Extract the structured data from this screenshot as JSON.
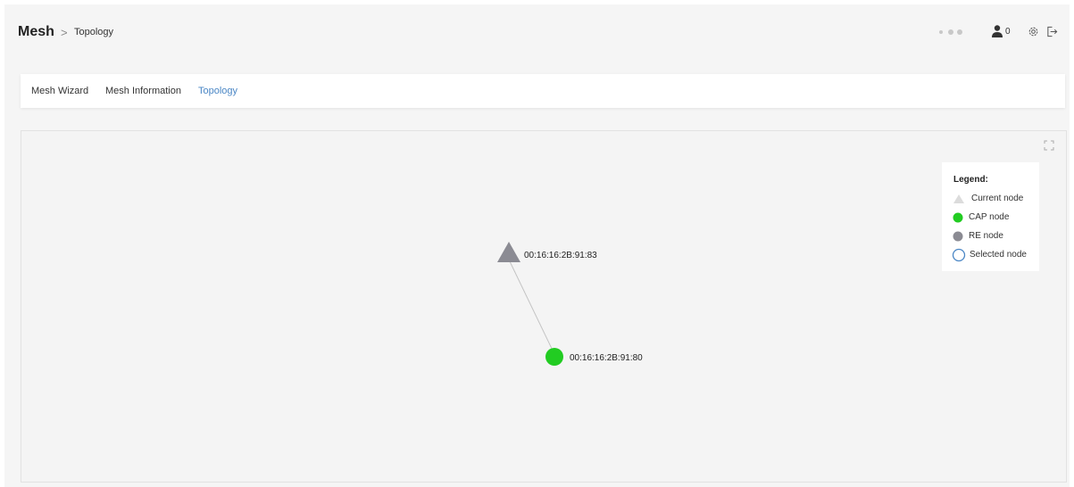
{
  "header": {
    "title": "Mesh",
    "separator": ">",
    "current": "Topology",
    "user_count": "0",
    "icons": [
      "status-dots-icon",
      "user-icon",
      "gear-icon",
      "logout-icon"
    ]
  },
  "tabs": [
    {
      "label": "Mesh Wizard",
      "active": false
    },
    {
      "label": "Mesh Information",
      "active": false
    },
    {
      "label": "Topology",
      "active": true
    }
  ],
  "colors": {
    "accent": "#4a86c5",
    "cap_node": "#22cc22",
    "re_node": "#8b8b93",
    "current_node": "#dcdcdc",
    "selected_node": "#4a86c5"
  },
  "topology": {
    "nodes": [
      {
        "mac": "00:16:16:2B:91:83",
        "shape": "triangle",
        "color": "#8b8b93"
      },
      {
        "mac": "00:16:16:2B:91:80",
        "shape": "circle",
        "color": "#22cc22"
      }
    ],
    "links": [
      [
        "00:16:16:2B:91:83",
        "00:16:16:2B:91:80"
      ]
    ]
  },
  "legend": {
    "title": "Legend:",
    "items": [
      {
        "label": "Current node",
        "icon": "triangle-icon"
      },
      {
        "label": "CAP node",
        "icon": "green-circle-icon"
      },
      {
        "label": "RE node",
        "icon": "gray-circle-icon"
      },
      {
        "label": "Selected node",
        "icon": "outline-circle-icon"
      }
    ]
  }
}
